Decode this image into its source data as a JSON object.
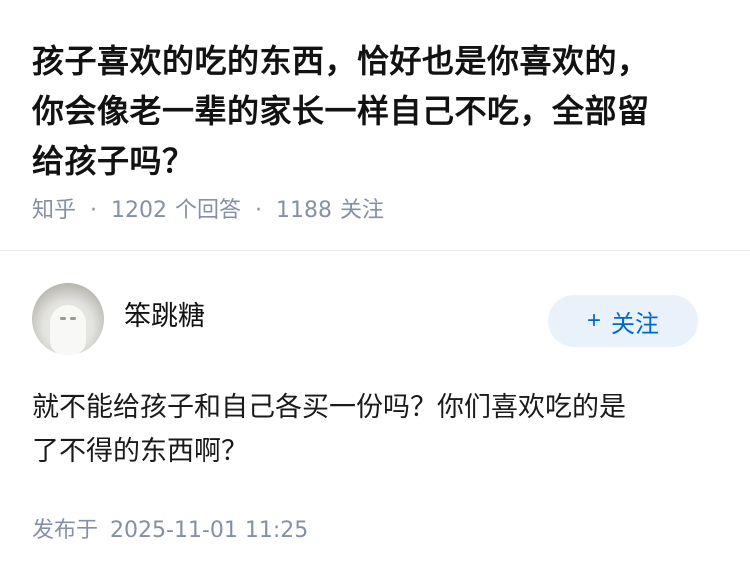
{
  "question": {
    "title_lines": [
      "孩子喜欢的吃的东西，恰好也是你喜欢的，",
      "你会像老一辈的家长一样自己不吃，全部留",
      "给孩子吗？"
    ],
    "source": "知乎",
    "answers_count": "1202",
    "answers_label": "个回答",
    "followers_count": "1188",
    "followers_label": "关注"
  },
  "answer": {
    "author_name": "笨跳糖",
    "avatar_icon": "snowy-owl-avatar",
    "follow_button": {
      "icon": "plus-icon",
      "plus": "+",
      "label": "关注"
    },
    "content_lines": [
      "就不能给孩子和自己各买一份吗？你们喜欢吃的是",
      "了不得的东西啊？"
    ],
    "publish_label": "发布于",
    "publish_time": "2025-11-01 11:25"
  },
  "colors": {
    "title": "#121212",
    "meta": "#8590a6",
    "follow_bg": "#e9f1fb",
    "follow_text": "#0066cc",
    "separator": "#ececec"
  }
}
